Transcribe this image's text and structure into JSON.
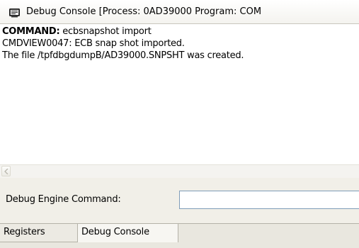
{
  "window": {
    "title": "Debug Console [Process: 0AD39000  Program: COM"
  },
  "console": {
    "lines": [
      {
        "prefix": "COMMAND:",
        "text": " ecbsnapshot import"
      },
      {
        "text": "CMDVIEW0047:   ECB snap shot imported."
      },
      {
        "text": "The file /tpfdbgdumpB/AD39000.SNPSHT was created."
      }
    ]
  },
  "command_bar": {
    "label": "Debug Engine Command:",
    "input_value": "",
    "input_placeholder": ""
  },
  "tabs": [
    {
      "label": "Registers",
      "active": false
    },
    {
      "label": "Debug Console",
      "active": true
    }
  ],
  "icons": {
    "title": "console-icon",
    "scroll_left": "scroll-left-arrow-icon"
  },
  "colors": {
    "input_border": "#7f9db9",
    "panel_bg": "#f1efe8",
    "tab_bar_bg": "#e9e7df"
  }
}
